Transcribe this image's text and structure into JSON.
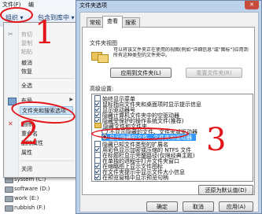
{
  "explorer": {
    "menu_bar": [
      "文件(F)",
      "编"
    ],
    "organize_label": "组织 ▾",
    "include_label": "包含到库中 ▾"
  },
  "organize_menu": {
    "items": [
      {
        "label": "剪切",
        "disabled": true
      },
      {
        "label": "复制",
        "disabled": true
      },
      {
        "label": "粘贴",
        "disabled": true
      },
      {
        "label": "撤消",
        "disabled": false
      },
      {
        "label": "恢复",
        "disabled": false
      },
      {
        "label": "全选",
        "disabled": false
      },
      {
        "label": "布局",
        "disabled": false
      },
      {
        "label": "文件夹和搜索选项",
        "disabled": false
      },
      {
        "label": "删除",
        "disabled": false
      },
      {
        "label": "重命名",
        "disabled": false
      },
      {
        "label": "删除属性",
        "disabled": false
      },
      {
        "label": "属性",
        "disabled": false
      },
      {
        "label": "关闭",
        "disabled": false
      }
    ]
  },
  "drives": [
    "system (C:)",
    "software (D:)",
    "work (E:)",
    "rubbish (F:)"
  ],
  "dialog": {
    "title": "文件夹选项",
    "close_label": "✕",
    "tabs": [
      "常规",
      "查看",
      "搜索"
    ],
    "active_tab": "查看",
    "folder_views_title": "文件夹视图",
    "folder_views_desc": "可以将该文件夹正在使用的视图(例如\"详细信息\"或\"图标\")应用到所有这种类型的文件夹中。",
    "apply_button": "应用到文件夹(L)",
    "reset_button": "重置文件夹(R)",
    "advanced_title": "高级设置:",
    "advanced_items": [
      {
        "label": "始终显示菜单",
        "type": "checkbox",
        "checked": false
      },
      {
        "label": "鼠标指向文件夹和桌面项时显示提示信息",
        "type": "checkbox",
        "checked": true
      },
      {
        "label": "显示驱动器号",
        "type": "checkbox",
        "checked": true
      },
      {
        "label": "隐藏计算机文件夹中的空驱动器",
        "type": "checkbox",
        "checked": true
      },
      {
        "label": "隐藏受保护的操作系统文件(推荐)",
        "type": "checkbox",
        "checked": true
      },
      {
        "label": "隐藏文件和文件夹",
        "type": "folder"
      },
      {
        "label": "不显示隐藏的文件、文件夹或驱动器",
        "type": "radio",
        "checked": false
      },
      {
        "label": "显示隐藏的文件、文件夹和驱动器",
        "type": "radio",
        "checked": true
      },
      {
        "label": "隐藏已知文件类型的扩展名",
        "type": "checkbox",
        "checked": false
      },
      {
        "label": "用彩色显示加密或压缩的 NTFS 文件",
        "type": "checkbox",
        "checked": true
      },
      {
        "label": "在标题栏显示完整路径(仅限经典主题)",
        "type": "checkbox",
        "checked": false
      },
      {
        "label": "在单独的进程中打开文件夹窗口",
        "type": "checkbox",
        "checked": false
      },
      {
        "label": "在缩略图上显示文件图标",
        "type": "checkbox",
        "checked": true
      },
      {
        "label": "在文件夹提示中显示文件大小信息",
        "type": "checkbox",
        "checked": true
      },
      {
        "label": "在预览窗格中显示预览句柄",
        "type": "checkbox",
        "checked": true
      }
    ],
    "restore_defaults_button": "还原为默认值(D)",
    "ok_button": "确定",
    "cancel_button": "取消",
    "apply_bottom_button": "应用(A)"
  },
  "annotations": [
    "1",
    "2",
    "3"
  ],
  "colors": {
    "annotation": "#e3151a",
    "selection": "#3399ff"
  }
}
